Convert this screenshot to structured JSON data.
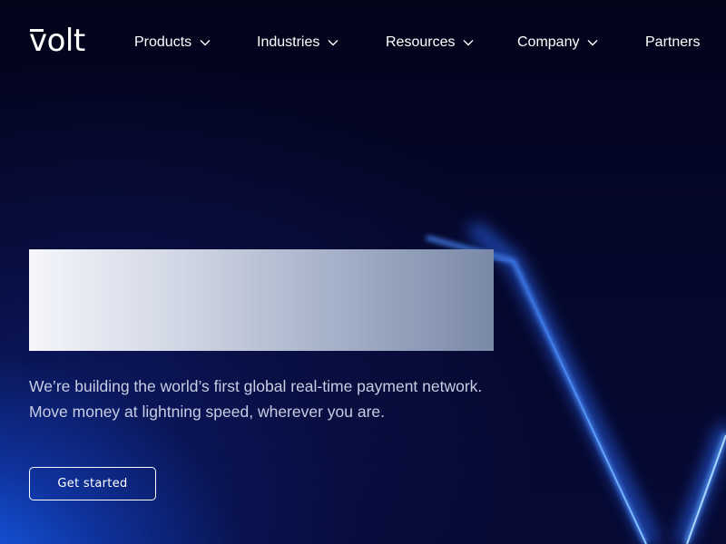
{
  "brand": {
    "name": "volt"
  },
  "nav": {
    "items": [
      {
        "label": "Products",
        "has_dropdown": true,
        "icon": "chevron-down-icon"
      },
      {
        "label": "Industries",
        "has_dropdown": true,
        "icon": "chevron-down-icon"
      },
      {
        "label": "Resources",
        "has_dropdown": true,
        "icon": "chevron-down-icon"
      },
      {
        "label": "Company",
        "has_dropdown": true,
        "icon": "chevron-down-icon"
      },
      {
        "label": "Partners",
        "has_dropdown": false
      }
    ]
  },
  "hero": {
    "tagline": "We’re building the world’s first global real-time payment network. Move money at lightning speed, wherever you are.",
    "cta_label": "Get started"
  },
  "colors": {
    "background": "#04051d",
    "glow": "#1866ff",
    "neon_line": "#4da3ff",
    "text": "#ffffff",
    "tagline": "#c7cde2"
  }
}
